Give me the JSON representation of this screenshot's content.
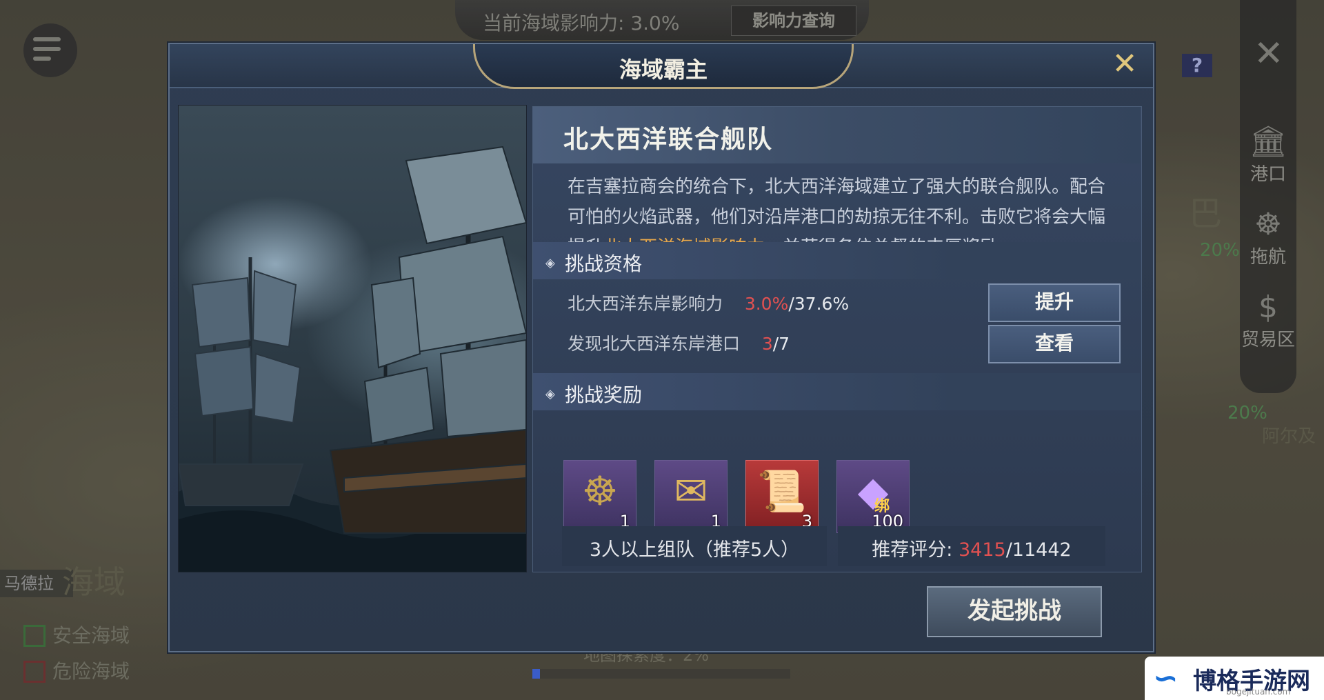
{
  "hud": {
    "influence_text": "当前海域影响力: 3.0%",
    "influence_query_button": "影响力查询",
    "help_label": "?",
    "right_rail": [
      {
        "label": "港口",
        "icon": "harbor-icon"
      },
      {
        "label": "拖航",
        "icon": "ship-wheel-icon"
      },
      {
        "label": "贸易区",
        "icon": "money-bag-icon"
      }
    ],
    "side_labels": [
      "巴",
      "阿尔及"
    ],
    "side_percents": [
      "20%",
      "20%"
    ],
    "left_region_label": "马德拉",
    "left_sea_text": "海域",
    "legend": [
      {
        "label": "安全海域",
        "color": "#3a6a3a"
      },
      {
        "label": "危险海域",
        "color": "#6a3030"
      }
    ],
    "explore_text": "地图探索度：2%",
    "explore_progress": 0.03
  },
  "dialog": {
    "title": "海域霸主",
    "fleet_name": "北大西洋联合舰队",
    "description_prefix": "在吉塞拉商会的统合下，北大西洋海域建立了强大的联合舰队。配合可怕的火焰武器，他们对沿岸港口的劫掠无往不利。击败它将会大幅提升",
    "description_highlight": "北大西洋海域影响力",
    "description_suffix": "，并获得各位总督的丰厚奖励。",
    "qualification": {
      "title": "挑战资格",
      "rows": [
        {
          "label": "北大西洋东岸影响力",
          "current": "3.0%",
          "target": "/37.6%",
          "button": "提升"
        },
        {
          "label": "发现北大西洋东岸港口",
          "current": "3",
          "target": "/7",
          "button": "查看"
        }
      ]
    },
    "rewards": {
      "title": "挑战奖励",
      "items": [
        {
          "icon": "compass-medal-icon",
          "count": "1"
        },
        {
          "icon": "sealed-letter-icon",
          "count": "1"
        },
        {
          "icon": "golden-scroll-icon",
          "count": "3"
        },
        {
          "icon": "purple-diamond-icon",
          "count": "100",
          "tag": "绑"
        }
      ]
    },
    "team_text": "3人以上组队（推荐5人）",
    "rating_label": "推荐评分: ",
    "rating_current": "3415",
    "rating_total": "/11442",
    "start_button": "发起挑战"
  },
  "watermark": {
    "name": "博格手游网",
    "url": "bogejituan.com"
  }
}
